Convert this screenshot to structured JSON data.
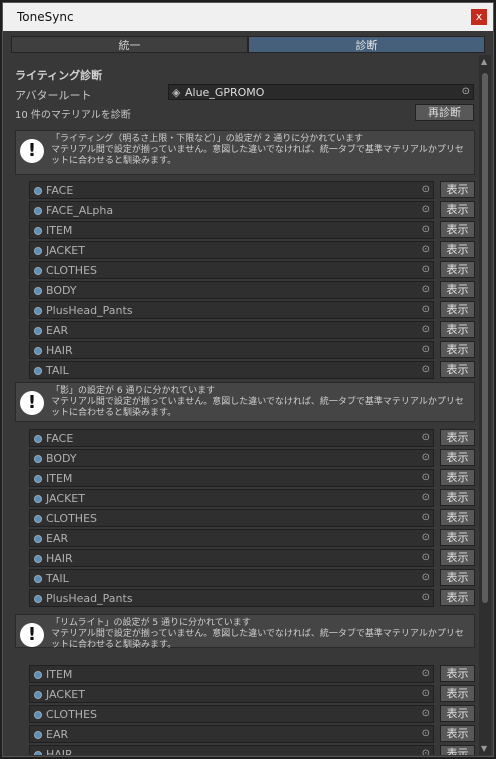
{
  "window": {
    "title": "ToneSync",
    "close_glyph": "x"
  },
  "tabs": [
    {
      "label": "統一"
    },
    {
      "label": "診断"
    }
  ],
  "diagnosis": {
    "section_title": "ライティング診断",
    "avatar_label": "アバタールート",
    "avatar_value": "Alue_GPROMO",
    "count_text": "10 件のマテリアルを診断",
    "rediagnose_label": "再診断",
    "show_label": "表示"
  },
  "groups": [
    {
      "title": "「ライティング（明るさ上限・下限など）」の設定が 2 通りに分かれています",
      "description": "マテリアル間で設定が揃っていません。意図した違いでなければ、統一タブで基準マテリアルかプリセットに合わせると馴染みます。",
      "materials": [
        "FACE",
        "FACE_ALpha",
        "ITEM",
        "JACKET",
        "CLOTHES",
        "BODY",
        "PlusHead_Pants",
        "EAR",
        "HAIR",
        "TAIL"
      ]
    },
    {
      "title": "「影」の設定が 6 通りに分かれています",
      "description": "マテリアル間で設定が揃っていません。意図した違いでなければ、統一タブで基準マテリアルかプリセットに合わせると馴染みます。",
      "materials": [
        "FACE",
        "BODY",
        "ITEM",
        "JACKET",
        "CLOTHES",
        "EAR",
        "HAIR",
        "TAIL",
        "PlusHead_Pants"
      ]
    },
    {
      "title": "「リムライト」の設定が 5 通りに分かれています",
      "description": "マテリアル間で設定が揃っていません。意図した違いでなければ、統一タブで基準マテリアルかプリセットに合わせると馴染みます。",
      "materials": [
        "ITEM",
        "JACKET",
        "CLOTHES",
        "EAR",
        "HAIR"
      ]
    }
  ]
}
